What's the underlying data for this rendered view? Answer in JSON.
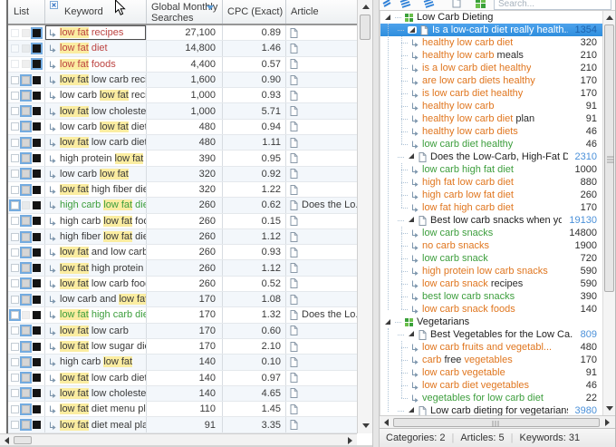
{
  "toolbar": {
    "search_placeholder": "Search...",
    "icons": [
      "keyword-list-blue-icon",
      "move-to-article-icon",
      "move-to-category-icon",
      "new-article-icon",
      "new-category-icon"
    ]
  },
  "table": {
    "headers": {
      "list": "List",
      "keyword": "Keyword",
      "searches": "Global Monthly Searches (Exact)",
      "cpc": "CPC (Exact)",
      "article": "Article"
    },
    "highlight_term": "low fat",
    "rows": [
      {
        "kw": "low fat recipes",
        "color": "red",
        "gms": "27,100",
        "cpc": "0.89",
        "article": "",
        "check": "third",
        "focused": true
      },
      {
        "kw": "low fat diet",
        "color": "red",
        "gms": "14,800",
        "cpc": "1.46",
        "article": "",
        "check": "third"
      },
      {
        "kw": "low fat foods",
        "color": "red",
        "gms": "4,400",
        "cpc": "0.57",
        "article": "",
        "check": "third"
      },
      {
        "kw": "low fat low carb reci...",
        "gms": "1,600",
        "cpc": "0.90",
        "article": "",
        "check": "mid"
      },
      {
        "kw": "low carb low fat reci...",
        "gms": "1,000",
        "cpc": "0.93",
        "article": "",
        "check": "mid"
      },
      {
        "kw": "low fat low cholester...",
        "gms": "1,000",
        "cpc": "5.71",
        "article": "",
        "check": "mid"
      },
      {
        "kw": "low carb low fat diet",
        "gms": "480",
        "cpc": "0.94",
        "article": "",
        "check": "mid"
      },
      {
        "kw": "low fat low carb diet",
        "gms": "480",
        "cpc": "1.11",
        "article": "",
        "check": "mid"
      },
      {
        "kw": "high protein low fat ...",
        "gms": "390",
        "cpc": "0.95",
        "article": "",
        "check": "mid"
      },
      {
        "kw": "low carb low fat",
        "gms": "320",
        "cpc": "0.92",
        "article": "",
        "check": "mid"
      },
      {
        "kw": "low fat high fiber diet",
        "gms": "320",
        "cpc": "1.22",
        "article": "",
        "check": "mid"
      },
      {
        "kw": "high carb low fat diet",
        "color": "green",
        "gms": "260",
        "cpc": "0.62",
        "article": "Does the Lo...",
        "check": "first"
      },
      {
        "kw": "high carb low fat foods",
        "gms": "260",
        "cpc": "0.15",
        "article": "",
        "check": "mid"
      },
      {
        "kw": "high fiber low fat diet",
        "gms": "260",
        "cpc": "1.12",
        "article": "",
        "check": "mid"
      },
      {
        "kw": "low fat and low carb ...",
        "gms": "260",
        "cpc": "0.93",
        "article": "",
        "check": "mid"
      },
      {
        "kw": "low fat high protein ...",
        "gms": "260",
        "cpc": "1.12",
        "article": "",
        "check": "mid"
      },
      {
        "kw": "low fat low carb foods",
        "gms": "260",
        "cpc": "0.52",
        "article": "",
        "check": "mid"
      },
      {
        "kw": "low carb and low fat ...",
        "gms": "170",
        "cpc": "1.08",
        "article": "",
        "check": "mid"
      },
      {
        "kw": "low fat high carb diet",
        "color": "green",
        "gms": "170",
        "cpc": "1.32",
        "article": "Does the Lo...",
        "check": "first"
      },
      {
        "kw": "low fat low carb",
        "gms": "170",
        "cpc": "0.60",
        "article": "",
        "check": "mid"
      },
      {
        "kw": "low fat low sugar diet",
        "gms": "170",
        "cpc": "2.10",
        "article": "",
        "check": "mid"
      },
      {
        "kw": "high carb low fat",
        "gms": "140",
        "cpc": "0.10",
        "article": "",
        "check": "mid"
      },
      {
        "kw": "low fat low carb diet ...",
        "gms": "140",
        "cpc": "0.97",
        "article": "",
        "check": "mid"
      },
      {
        "kw": "low fat low cholester...",
        "gms": "140",
        "cpc": "4.65",
        "article": "",
        "check": "mid"
      },
      {
        "kw": "low fat diet menu plan",
        "gms": "110",
        "cpc": "1.45",
        "article": "",
        "check": "mid"
      },
      {
        "kw": "low fat diet meal plan",
        "gms": "91",
        "cpc": "3.35",
        "article": "",
        "check": "mid"
      }
    ]
  },
  "tree": {
    "categories": [
      {
        "label": "Low Carb Dieting",
        "articles": [
          {
            "label": "Is a low-carb diet really health...",
            "count": "1354",
            "selected": true,
            "keywords": [
              {
                "segs": [
                  {
                    "t": "healthy low carb diet",
                    "c": "orange"
                  }
                ],
                "count": "320"
              },
              {
                "segs": [
                  {
                    "t": "healthy low carb ",
                    "c": "orange"
                  },
                  {
                    "t": "meals",
                    "c": "black"
                  }
                ],
                "count": "210"
              },
              {
                "segs": [
                  {
                    "t": "is a low carb diet healthy",
                    "c": "orange"
                  }
                ],
                "count": "210"
              },
              {
                "segs": [
                  {
                    "t": "are low carb diets healthy",
                    "c": "orange"
                  }
                ],
                "count": "170"
              },
              {
                "segs": [
                  {
                    "t": "is low carb diet healthy",
                    "c": "orange"
                  }
                ],
                "count": "170"
              },
              {
                "segs": [
                  {
                    "t": "healthy low carb",
                    "c": "orange"
                  }
                ],
                "count": "91"
              },
              {
                "segs": [
                  {
                    "t": "healthy low carb diet ",
                    "c": "orange"
                  },
                  {
                    "t": "plan",
                    "c": "black"
                  }
                ],
                "count": "91"
              },
              {
                "segs": [
                  {
                    "t": "healthy low carb diets",
                    "c": "orange"
                  }
                ],
                "count": "46"
              },
              {
                "segs": [
                  {
                    "t": "low carb diet healthy",
                    "c": "green"
                  }
                ],
                "count": "46"
              }
            ]
          },
          {
            "label": "Does the Low-Carb, High-Fat Di...",
            "count": "2310",
            "keywords": [
              {
                "segs": [
                  {
                    "t": "low carb high fat diet",
                    "c": "green"
                  }
                ],
                "count": "1000"
              },
              {
                "segs": [
                  {
                    "t": "high fat low carb diet",
                    "c": "orange"
                  }
                ],
                "count": "880"
              },
              {
                "segs": [
                  {
                    "t": "high carb low fat diet",
                    "c": "orange"
                  }
                ],
                "count": "260"
              },
              {
                "segs": [
                  {
                    "t": "low fat high carb diet",
                    "c": "orange"
                  }
                ],
                "count": "170"
              }
            ]
          },
          {
            "label": "Best low carb snacks when you'...",
            "count": "19130",
            "keywords": [
              {
                "segs": [
                  {
                    "t": "low carb snacks",
                    "c": "green"
                  }
                ],
                "count": "14800"
              },
              {
                "segs": [
                  {
                    "t": "no carb snacks",
                    "c": "orange"
                  }
                ],
                "count": "1900"
              },
              {
                "segs": [
                  {
                    "t": "low carb snack",
                    "c": "green"
                  }
                ],
                "count": "720"
              },
              {
                "segs": [
                  {
                    "t": "high protein low carb snacks",
                    "c": "orange"
                  }
                ],
                "count": "590"
              },
              {
                "segs": [
                  {
                    "t": "low carb snack ",
                    "c": "orange"
                  },
                  {
                    "t": "recipes",
                    "c": "black"
                  }
                ],
                "count": "590"
              },
              {
                "segs": [
                  {
                    "t": "best low carb snacks",
                    "c": "green"
                  }
                ],
                "count": "390"
              },
              {
                "segs": [
                  {
                    "t": "low carb snack foods",
                    "c": "orange"
                  }
                ],
                "count": "140"
              }
            ]
          }
        ]
      },
      {
        "label": "Vegetarians",
        "articles": [
          {
            "label": "Best Vegetables for the Low Ca...",
            "count": "809",
            "keywords": [
              {
                "segs": [
                  {
                    "t": "low carb fruits and vegetabl...",
                    "c": "orange"
                  }
                ],
                "count": "480"
              },
              {
                "segs": [
                  {
                    "t": "carb ",
                    "c": "orange"
                  },
                  {
                    "t": "free",
                    "c": "black"
                  },
                  {
                    "t": " vegetables",
                    "c": "orange"
                  }
                ],
                "count": "170"
              },
              {
                "segs": [
                  {
                    "t": "low carb vegetable",
                    "c": "orange"
                  }
                ],
                "count": "91"
              },
              {
                "segs": [
                  {
                    "t": "low carb diet vegetables",
                    "c": "orange"
                  }
                ],
                "count": "46"
              },
              {
                "segs": [
                  {
                    "t": "vegetables for low carb diet",
                    "c": "green"
                  }
                ],
                "count": "22"
              }
            ]
          },
          {
            "label": "Low carb dieting for vegetarians",
            "count": "3980",
            "keywords": []
          }
        ]
      }
    ]
  },
  "status": {
    "items": [
      {
        "label": "Categories:",
        "value": "2"
      },
      {
        "label": "Articles:",
        "value": "5"
      },
      {
        "label": "Keywords:",
        "value": "31"
      }
    ]
  },
  "colors": {
    "selection_blue": "#3896e4",
    "link_blue": "#4a90d9",
    "keyword_orange": "#e0761f",
    "keyword_green": "#3d9e3d",
    "keyword_red": "#bc4341",
    "highlight_yellow": "#fbeda1"
  }
}
